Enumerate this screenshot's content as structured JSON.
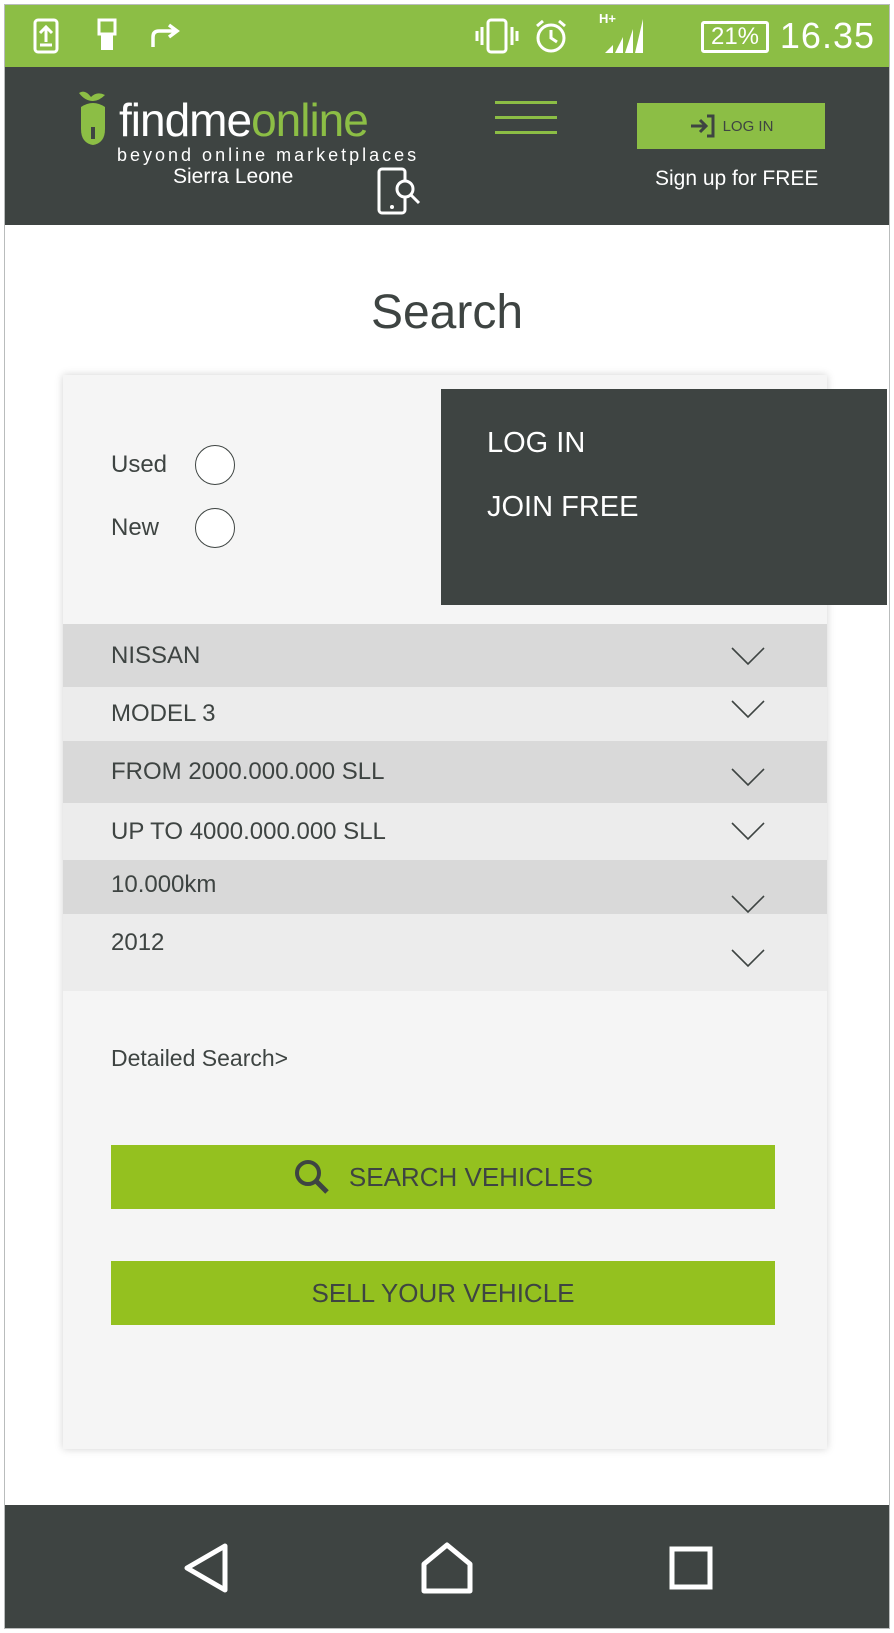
{
  "status_bar": {
    "battery": "21%",
    "time": "16.35",
    "network": "H+"
  },
  "header": {
    "logo_find": "findme",
    "logo_online": "online",
    "tagline": "beyond online marketplaces",
    "region": "Sierra Leone",
    "login_label": "LOG IN",
    "signup_label": "Sign up for FREE"
  },
  "page": {
    "title": "Search"
  },
  "condition": {
    "options": [
      "Used",
      "New"
    ]
  },
  "filters": [
    {
      "label": "NISSAN"
    },
    {
      "label": "MODEL 3"
    },
    {
      "label": "FROM 2000.000.000 SLL"
    },
    {
      "label": "UP TO 4000.000.000 SLL"
    },
    {
      "label": "10.000km"
    },
    {
      "label": "2012"
    }
  ],
  "links": {
    "detailed_search": "Detailed Search>"
  },
  "buttons": {
    "search": "SEARCH VEHICLES",
    "sell": "SELL YOUR VEHICLE"
  },
  "dropdown_menu": {
    "items": [
      "LOG IN",
      "JOIN FREE"
    ]
  },
  "colors": {
    "accent": "#8cbe45",
    "button_green": "#94c11f",
    "header_dark": "#3e4442"
  },
  "icons": {
    "status_left": [
      "upload-sim-icon",
      "usb-icon",
      "share-icon"
    ],
    "status_right": [
      "vibrate-icon",
      "alarm-icon",
      "signal-icon",
      "battery-icon"
    ],
    "header": [
      "acorn-logo-icon",
      "menu-icon",
      "phone-search-icon",
      "login-arrow-icon"
    ],
    "nav": [
      "back-icon",
      "home-icon",
      "recents-icon"
    ]
  }
}
